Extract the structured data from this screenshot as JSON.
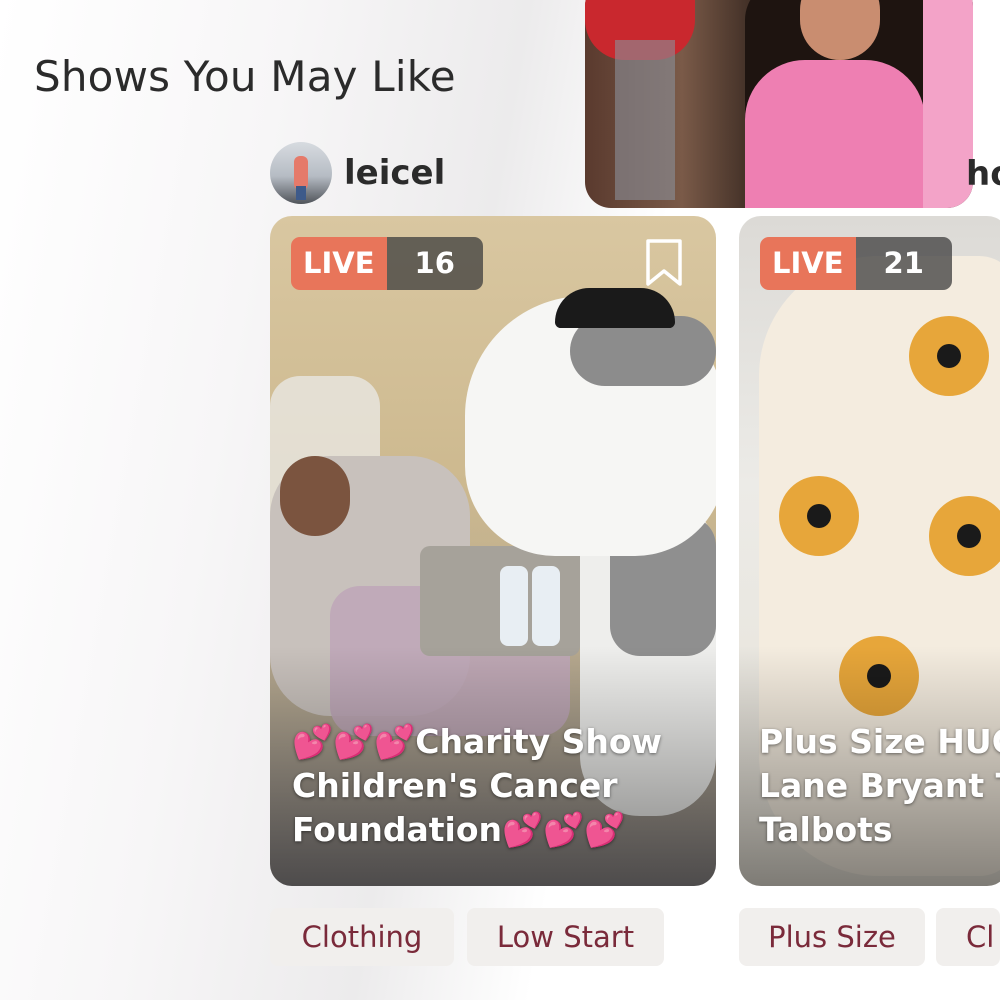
{
  "section": {
    "title": "Shows You May Like"
  },
  "top_card": {
    "edge_text": "ho"
  },
  "seller": {
    "name": "leicel"
  },
  "shows": [
    {
      "live_label": "LIVE",
      "viewers": "16",
      "title": "💕💕💕Charity Show\nChildren's Cancer\nFoundation💕💕💕",
      "tags": [
        "Clothing",
        "Low Start"
      ]
    },
    {
      "live_label": "LIVE",
      "viewers": "21",
      "title": "Plus Size HUG\nLane Bryant To\nTalbots",
      "tags": [
        "Plus Size",
        "Cl"
      ]
    }
  ],
  "colors": {
    "live": "#e8755a",
    "tag_text": "#7a2a3a",
    "tag_bg": "#f1efed",
    "heading": "#2b2b2b"
  },
  "icons": [
    "bookmark-icon",
    "avatar"
  ]
}
